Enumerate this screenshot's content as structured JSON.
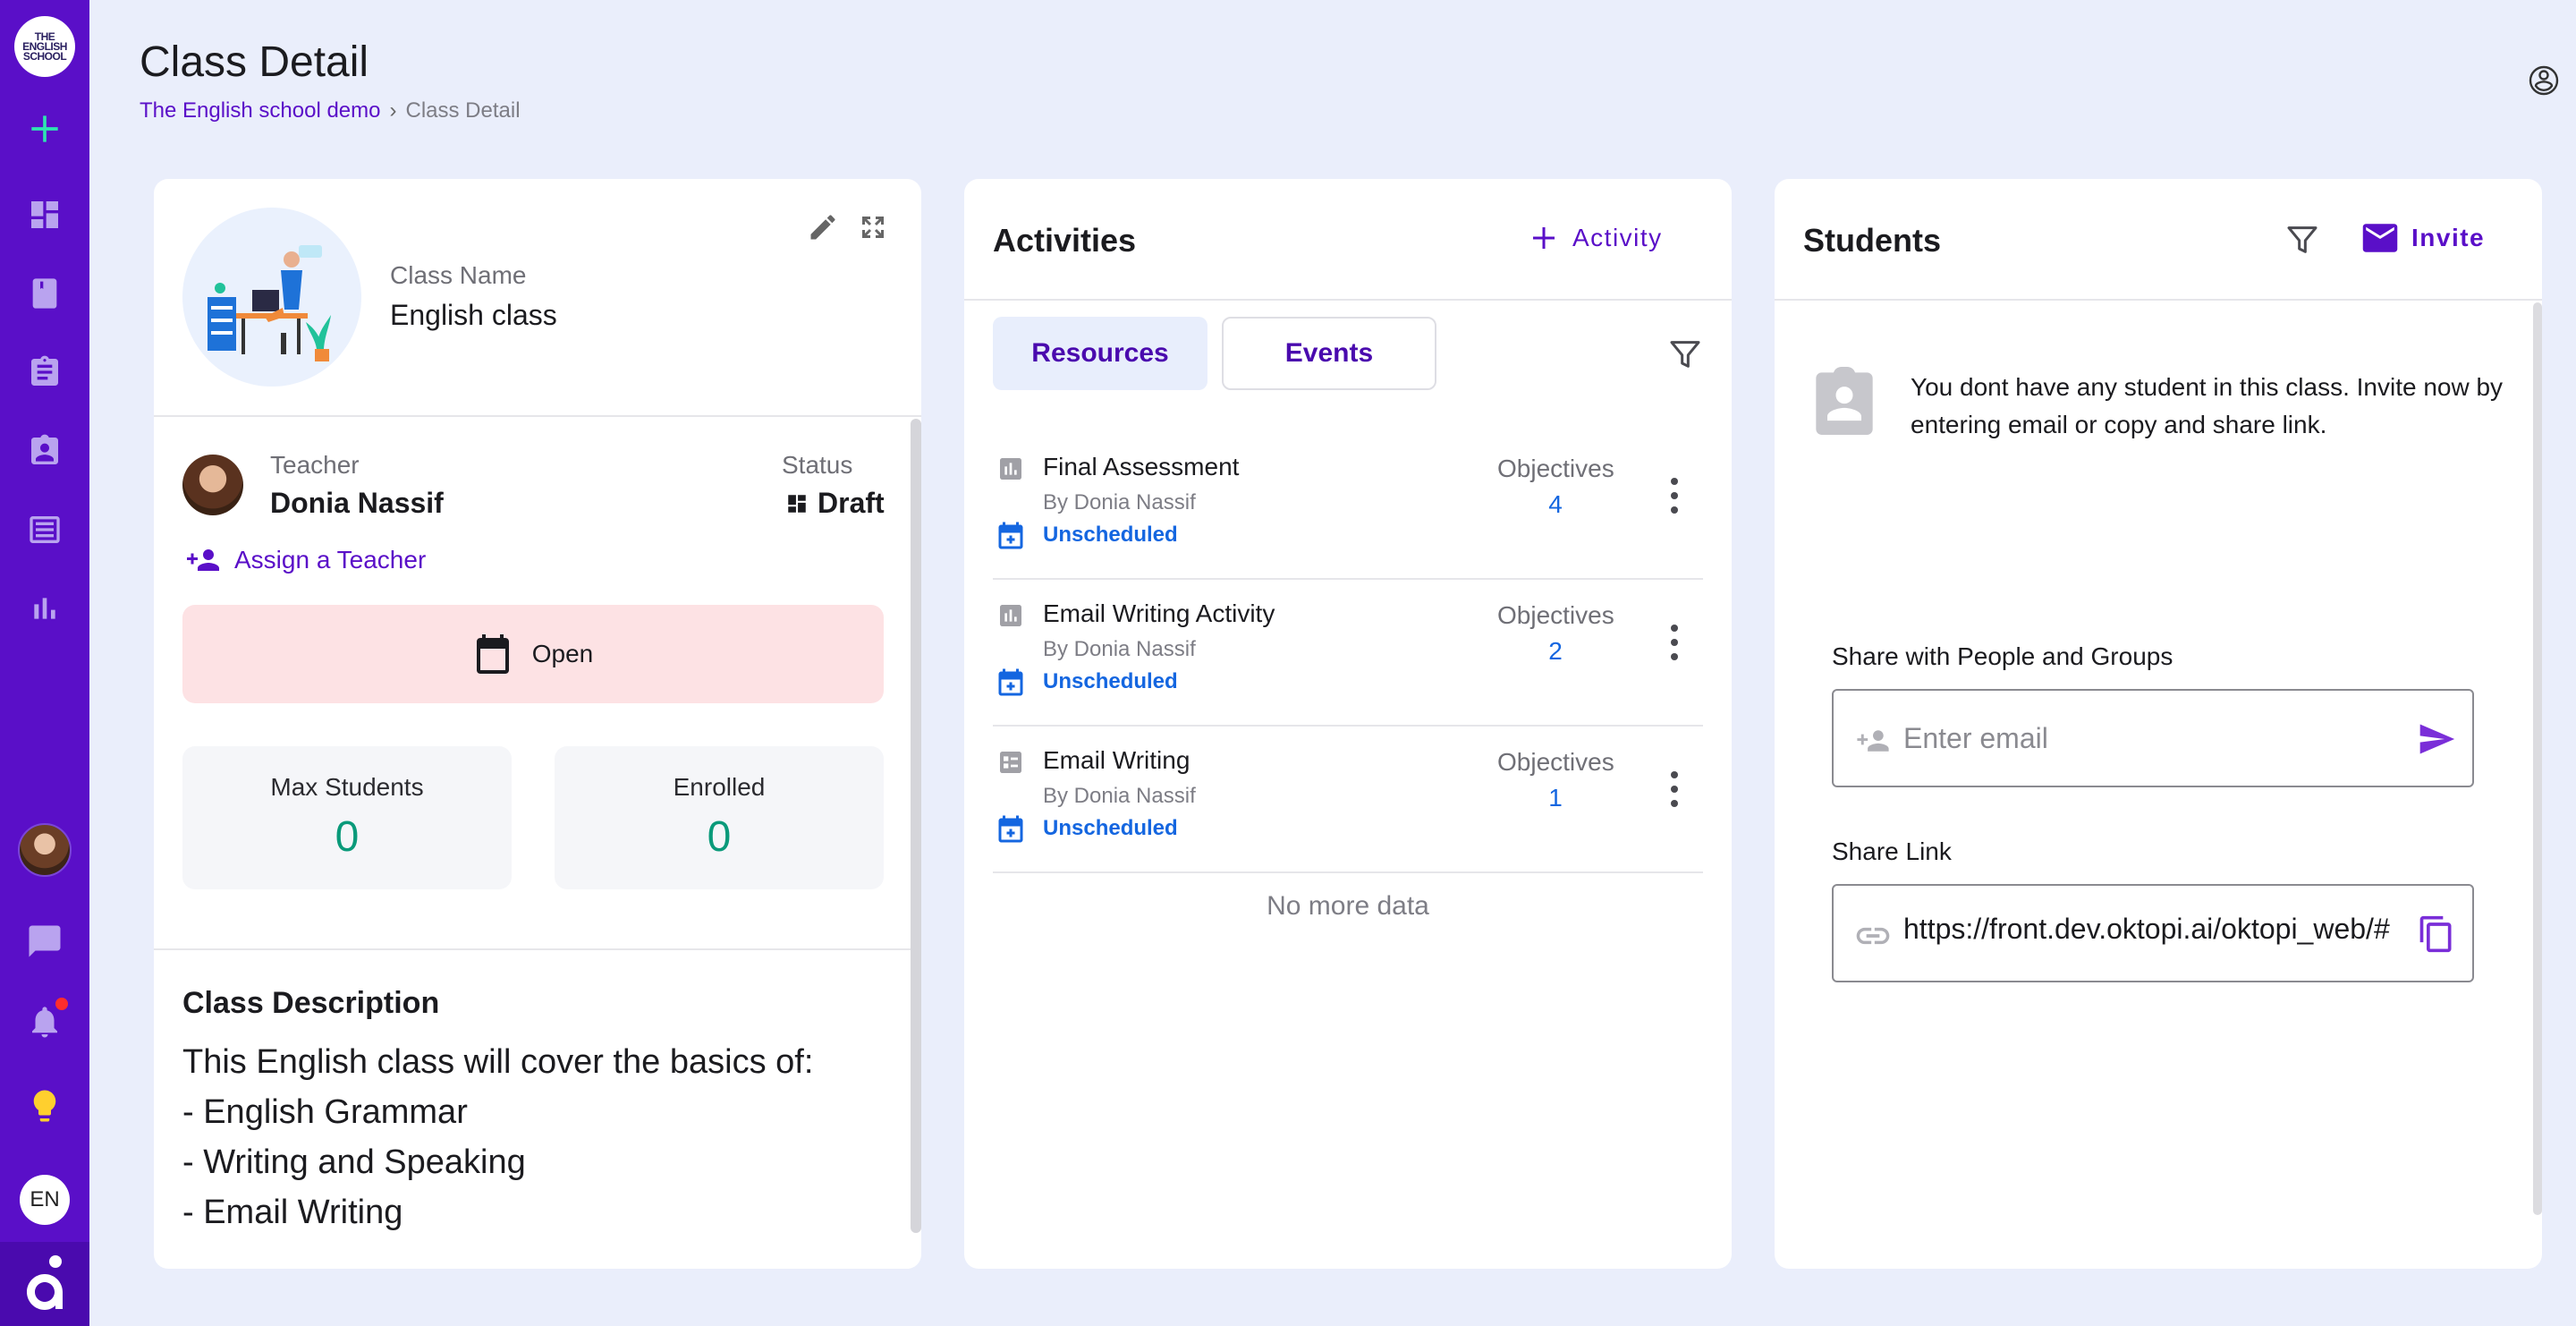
{
  "sidebar": {
    "logo_lines": [
      "THE",
      "ENGLISH",
      "SCHOOL"
    ],
    "lang": "EN",
    "icons": [
      "add-icon",
      "dashboard-icon",
      "book-icon",
      "clipboard-icon",
      "badge-icon",
      "article-icon",
      "bar-chart-icon",
      "chat-icon",
      "bell-icon",
      "lightbulb-icon"
    ]
  },
  "header": {
    "title": "Class Detail",
    "breadcrumb": {
      "link": "The English school demo",
      "current": "Class Detail"
    }
  },
  "class_card": {
    "name_label": "Class Name",
    "name_value": "English class",
    "teacher_label": "Teacher",
    "teacher_value": "Donia Nassif",
    "status_label": "Status",
    "status_value": "Draft",
    "assign_label": "Assign a Teacher",
    "open_label": "Open",
    "max_students_label": "Max Students",
    "max_students_value": "0",
    "enrolled_label": "Enrolled",
    "enrolled_value": "0",
    "description_title": "Class Description",
    "description_lines": [
      "This English class will cover the basics of:",
      "- English Grammar",
      "- Writing and Speaking",
      "- Email Writing"
    ]
  },
  "activities_card": {
    "title": "Activities",
    "add_label": "Activity",
    "tabs": [
      {
        "label": "Resources"
      },
      {
        "label": "Events"
      }
    ],
    "objectives_label": "Objectives",
    "items": [
      {
        "title": "Final Assessment",
        "by": "By Donia Nassif",
        "schedule": "Unscheduled",
        "objectives": "4"
      },
      {
        "title": "Email Writing Activity",
        "by": "By Donia Nassif",
        "schedule": "Unscheduled",
        "objectives": "2"
      },
      {
        "title": "Email Writing",
        "by": "By Donia Nassif",
        "schedule": "Unscheduled",
        "objectives": "1"
      }
    ],
    "no_more": "No more data"
  },
  "students_card": {
    "title": "Students",
    "invite_label": "Invite",
    "empty_text": "You dont have any student in this class. Invite now by entering email or copy and share link.",
    "share_label": "Share with People and Groups",
    "email_placeholder": "Enter email",
    "link_label": "Share Link",
    "link_value": "https://front.dev.oktopi.ai/oktopi_web/#"
  },
  "colors": {
    "accent": "#5a0fc8",
    "sidebar": "#5a0fc8",
    "teal": "#0a9a7a",
    "link_blue": "#1466e0",
    "open_bg": "#fde2e4"
  }
}
